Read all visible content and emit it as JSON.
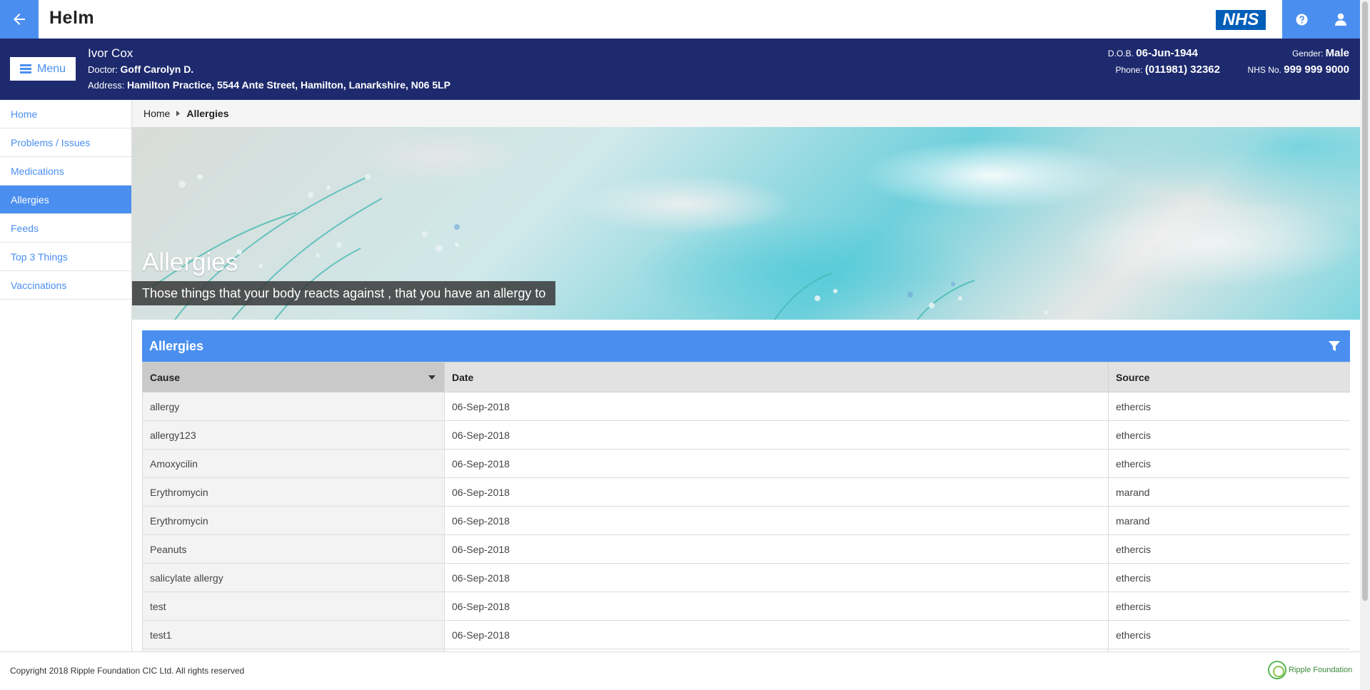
{
  "app": {
    "title": "Helm",
    "nhs_logo_text": "NHS"
  },
  "topbar": {
    "back_icon": "arrow-left-icon",
    "help_icon": "question-circle-icon",
    "user_icon": "user-icon"
  },
  "patient": {
    "menu_label": "Menu",
    "name": "Ivor Cox",
    "doctor_label": "Doctor:",
    "doctor": "Goff Carolyn D.",
    "address_label": "Address:",
    "address": "Hamilton Practice, 5544 Ante Street, Hamilton, Lanarkshire, N06 5LP",
    "dob_label": "D.O.B.",
    "dob": "06-Jun-1944",
    "gender_label": "Gender:",
    "gender": "Male",
    "phone_label": "Phone:",
    "phone": "(011981) 32362",
    "nhs_label": "NHS No.",
    "nhs_no": "999 999 9000"
  },
  "sidebar": {
    "items": [
      {
        "label": "Home",
        "active": false
      },
      {
        "label": "Problems / Issues",
        "active": false
      },
      {
        "label": "Medications",
        "active": false
      },
      {
        "label": "Allergies",
        "active": true
      },
      {
        "label": "Feeds",
        "active": false
      },
      {
        "label": "Top 3 Things",
        "active": false
      },
      {
        "label": "Vaccinations",
        "active": false
      }
    ]
  },
  "breadcrumb": {
    "home": "Home",
    "current": "Allergies"
  },
  "hero": {
    "title": "Allergies",
    "subtitle": "Those things that your body reacts against , that you have an allergy to"
  },
  "panel": {
    "title": "Allergies",
    "filter_icon": "filter-icon",
    "columns": [
      "Cause",
      "Date",
      "Source"
    ],
    "sorted_column": "Cause",
    "rows": [
      [
        "allergy",
        "06-Sep-2018",
        "ethercis"
      ],
      [
        "allergy123",
        "06-Sep-2018",
        "ethercis"
      ],
      [
        "Amoxycilin",
        "06-Sep-2018",
        "ethercis"
      ],
      [
        "Erythromycin",
        "06-Sep-2018",
        "marand"
      ],
      [
        "Erythromycin",
        "06-Sep-2018",
        "marand"
      ],
      [
        "Peanuts",
        "06-Sep-2018",
        "ethercis"
      ],
      [
        "salicylate allergy",
        "06-Sep-2018",
        "ethercis"
      ],
      [
        "test",
        "06-Sep-2018",
        "ethercis"
      ],
      [
        "test1",
        "06-Sep-2018",
        "ethercis"
      ],
      [
        "",
        "",
        ""
      ]
    ]
  },
  "footer": {
    "copyright": "Copyright 2018 Ripple Foundation CIC Ltd. All rights reserved",
    "logo_text": "Ripple Foundation"
  },
  "colors": {
    "accent": "#4a8ff0",
    "banner": "#1e2a6e",
    "active_nav": "#4a8ff0"
  }
}
